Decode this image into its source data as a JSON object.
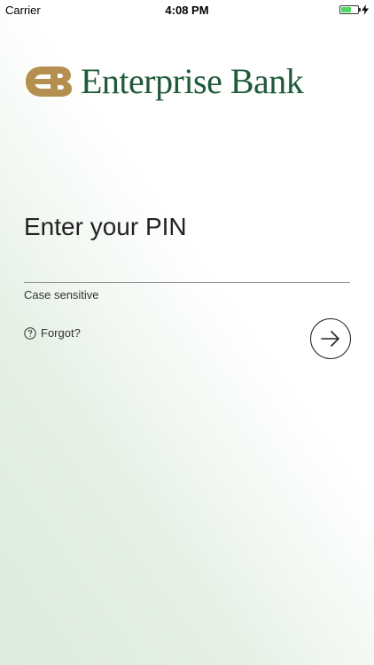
{
  "status_bar": {
    "carrier": "Carrier",
    "time": "4:08 PM",
    "battery_level": 0.65,
    "battery_color": "#4cd964"
  },
  "brand": {
    "name": "Enterprise Bank",
    "text_color": "#1f5a3a",
    "mark_color": "#b48f4f",
    "mark_icon": "enterprise-bank-logo-icon"
  },
  "login": {
    "title": "Enter your PIN",
    "pin_value": "",
    "hint": "Case sensitive",
    "forgot_label": "Forgot?",
    "forgot_icon": "help-circle-icon",
    "submit_icon": "arrow-right-circle-icon"
  }
}
